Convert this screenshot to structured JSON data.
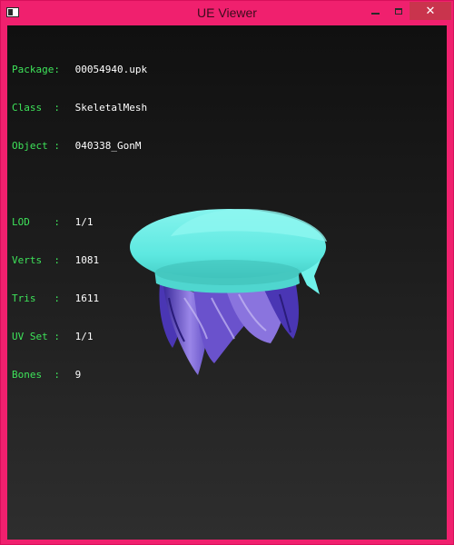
{
  "window": {
    "title": "UE Viewer",
    "controls": {
      "minimize_icon": "minimize-icon",
      "maximize_icon": "maximize-icon",
      "close_icon": "close-icon",
      "close_glyph": "✕"
    }
  },
  "info": {
    "package_label": "Package:",
    "package": "00054940.upk",
    "class_label": "Class  :",
    "class": "SkeletalMesh",
    "object_label": "Object :",
    "object": "040338_GonM",
    "lod_label": "LOD    :",
    "lod": "1/1",
    "verts_label": "Verts  :",
    "verts": "1081",
    "tris_label": "Tris   :",
    "tris": "1611",
    "uvset_label": "UV Set :",
    "uvset": "1/1",
    "bones_label": "Bones  :",
    "bones": "9"
  },
  "colors": {
    "title_bar": "#f0206e",
    "info_label": "#3ee35a",
    "info_value": "#ffffff",
    "hat": "#5de8e0",
    "hair": "#7b52d6"
  }
}
